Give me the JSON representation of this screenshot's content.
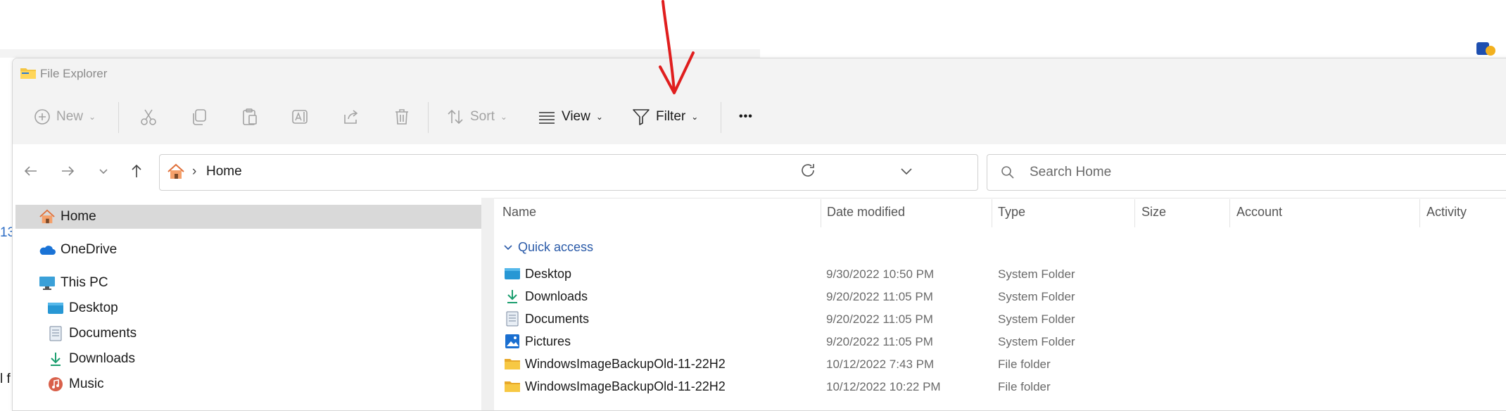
{
  "window": {
    "title": "File Explorer"
  },
  "toolbar": {
    "new_label": "New",
    "sort_label": "Sort",
    "view_label": "View",
    "filter_label": "Filter",
    "more_label": "•••"
  },
  "address": {
    "separator": "›",
    "current": "Home"
  },
  "search": {
    "placeholder": "Search Home"
  },
  "sidebar": {
    "items": [
      {
        "label": "Home",
        "icon": "home-icon",
        "selected": true
      },
      {
        "label": "OneDrive",
        "icon": "cloud-icon"
      },
      {
        "label": "This PC",
        "icon": "monitor-icon"
      },
      {
        "label": "Desktop",
        "icon": "desktop-folder-icon"
      },
      {
        "label": "Documents",
        "icon": "documents-icon"
      },
      {
        "label": "Downloads",
        "icon": "download-icon"
      },
      {
        "label": "Music",
        "icon": "music-icon"
      }
    ]
  },
  "columns": [
    "Name",
    "Date modified",
    "Type",
    "Size",
    "Account",
    "Activity"
  ],
  "quick_access": {
    "label": "Quick access",
    "items": [
      {
        "name": "Desktop",
        "date": "9/30/2022 10:50 PM",
        "type": "System Folder",
        "icon": "desktop-folder-icon"
      },
      {
        "name": "Downloads",
        "date": "9/20/2022 11:05 PM",
        "type": "System Folder",
        "icon": "download-icon"
      },
      {
        "name": "Documents",
        "date": "9/20/2022 11:05 PM",
        "type": "System Folder",
        "icon": "documents-icon"
      },
      {
        "name": "Pictures",
        "date": "9/20/2022 11:05 PM",
        "type": "System Folder",
        "icon": "pictures-icon"
      },
      {
        "name": "WindowsImageBackupOld-11-22H2",
        "date": "10/12/2022 7:43 PM",
        "type": "File folder",
        "icon": "folder-icon"
      },
      {
        "name": "WindowsImageBackupOld-11-22H2",
        "date": "10/12/2022 10:22 PM",
        "type": "File folder",
        "icon": "folder-icon"
      }
    ]
  },
  "backdrop": {
    "left_text_1": "13",
    "left_text_2": "l f"
  },
  "colors": {
    "accent": "#0067c0",
    "annotation": "#e01e1e",
    "folder": "#f4c542"
  }
}
